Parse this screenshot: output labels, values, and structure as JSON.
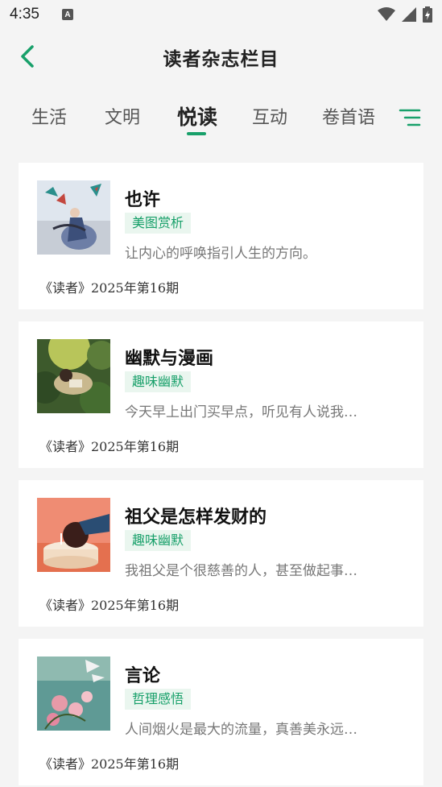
{
  "status_bar": {
    "time": "4:35",
    "notification_icon": "a-icon",
    "icons": [
      "wifi-icon",
      "signal-icon",
      "battery-icon"
    ]
  },
  "header": {
    "back_icon": "chevron-left-icon",
    "title": "读者杂志栏目"
  },
  "tabs": [
    {
      "label": "生活",
      "active": false
    },
    {
      "label": "文明",
      "active": false
    },
    {
      "label": "悦读",
      "active": true
    },
    {
      "label": "互动",
      "active": false
    },
    {
      "label": "卷首语",
      "active": false
    }
  ],
  "menu_icon": "menu-icon",
  "colors": {
    "accent": "#18a06a",
    "tag_bg": "#eaf6ef",
    "page_bg": "#f4f4f4"
  },
  "articles": [
    {
      "title": "也许",
      "tag": "美图赏析",
      "summary": "让内心的呼唤指引人生的方向。",
      "source": "《读者》2025年第16期",
      "image": "kite-girl-illustration"
    },
    {
      "title": "幽默与漫画",
      "tag": "趣味幽默",
      "summary": "今天早上出门买早点，听见有人说我…",
      "source": "《读者》2025年第16期",
      "image": "reading-in-forest-illustration"
    },
    {
      "title": "祖父是怎样发财的",
      "tag": "趣味幽默",
      "summary": "我祖父是个很慈善的人，甚至做起事…",
      "source": "《读者》2025年第16期",
      "image": "head-on-cake-illustration"
    },
    {
      "title": "言论",
      "tag": "哲理感悟",
      "summary": "人间烟火是最大的流量，真善美永远…",
      "source": "《读者》2025年第16期",
      "image": "flowers-and-birds-illustration"
    }
  ]
}
